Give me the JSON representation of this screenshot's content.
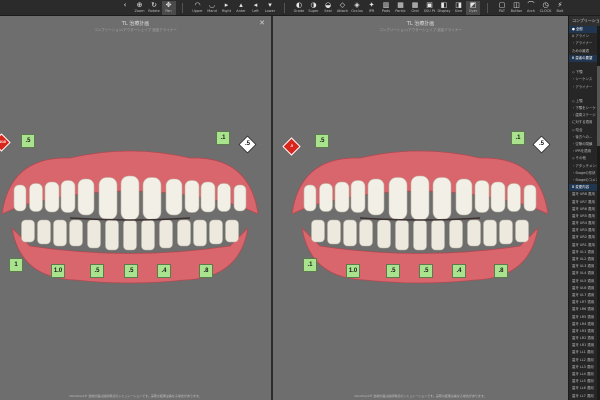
{
  "toolbar": {
    "tools": [
      {
        "label": "",
        "icon": "chevron-left",
        "glyph": "‹"
      },
      {
        "label": "Zoom",
        "icon": "zoom",
        "glyph": "⊕"
      },
      {
        "label": "Rotate",
        "icon": "rotate",
        "glyph": "↻"
      },
      {
        "label": "Pan",
        "icon": "pan",
        "glyph": "✥"
      },
      {
        "label": "",
        "icon": "separator",
        "glyph": ""
      },
      {
        "label": "Upper",
        "icon": "upper",
        "glyph": "◠"
      },
      {
        "label": "Mand",
        "icon": "mand",
        "glyph": "◡"
      },
      {
        "label": "Right",
        "icon": "right",
        "glyph": "▸"
      },
      {
        "label": "Anter",
        "icon": "anter",
        "glyph": "▴"
      },
      {
        "label": "Left",
        "icon": "left",
        "glyph": "◂"
      },
      {
        "label": "Lower",
        "icon": "lower",
        "glyph": "▾"
      },
      {
        "label": "",
        "icon": "separator",
        "glyph": ""
      },
      {
        "label": "Grade",
        "icon": "grade",
        "glyph": "◐"
      },
      {
        "label": "Super",
        "icon": "super",
        "glyph": "◑"
      },
      {
        "label": "Seal",
        "icon": "seal",
        "glyph": "◒"
      },
      {
        "label": "Attach",
        "icon": "attach",
        "glyph": "◇"
      },
      {
        "label": "Occlus",
        "icon": "occlusion",
        "glyph": "◈"
      },
      {
        "label": "IPR",
        "icon": "ipr",
        "glyph": "✦"
      },
      {
        "label": "Pads",
        "icon": "pads",
        "glyph": "▥"
      },
      {
        "label": "Pontic",
        "icon": "pontic",
        "glyph": "▦"
      },
      {
        "label": "Grid",
        "icon": "grid",
        "glyph": "▦"
      },
      {
        "label": "SSU Pt",
        "icon": "ssu",
        "glyph": "▣"
      },
      {
        "label": "Display",
        "icon": "display",
        "glyph": "◧"
      },
      {
        "label": "Sine",
        "icon": "sine",
        "glyph": "◨"
      },
      {
        "label": "Over",
        "icon": "over",
        "glyph": "◩"
      },
      {
        "label": "",
        "icon": "separator",
        "glyph": ""
      },
      {
        "label": "PAT",
        "icon": "pat",
        "glyph": "▢"
      },
      {
        "label": "Button",
        "icon": "button",
        "glyph": "◫"
      },
      {
        "label": "Arch",
        "icon": "arch",
        "glyph": "⌒"
      },
      {
        "label": "CLOCK",
        "icon": "clock",
        "glyph": "◷"
      },
      {
        "label": "Bolt",
        "icon": "bolt",
        "glyph": "⚡"
      }
    ]
  },
  "viewports": [
    {
      "title": "TL 治療計画",
      "subtitle": "コンプリーション/アウターシェイプ 追加アライナー",
      "footer": "ClinCheck® 治療計画は提供時点のシミュレーションです。実際の結果は異なる場合があります。",
      "labels": [
        ".5",
        ".1",
        "1",
        "1.0",
        ".5",
        ".5",
        ".4",
        ".8"
      ],
      "diamond_white": ".5",
      "diamond_red": "14/15"
    },
    {
      "title": "",
      "subtitle": "",
      "footer": "ClinCheck® 治療計画は提供時点のシミュレーションです。実際の結果は異なる場合があります。",
      "labels": [
        ".5",
        ".1",
        ".1",
        "1.0",
        ".5",
        ".5",
        ".4",
        ".8"
      ],
      "diamond_white": ".5",
      "diamond_red": ".5"
    }
  ],
  "side_panel": {
    "title": "コンプリーション",
    "rows": [
      {
        "text": "● 全般",
        "head": true
      },
      {
        "text": "A アライン",
        "head": false
      },
      {
        "text": "・アライナー",
        "head": false
      },
      {
        "text": "ための最適",
        "head": false
      },
      {
        "text": "B 患者の要望",
        "head": true
      },
      {
        "text": "",
        "head": false
      },
      {
        "text": "◇ 下顎",
        "head": false
      },
      {
        "text": "・シーケンス",
        "head": false
      },
      {
        "text": "・アライナー",
        "head": false
      },
      {
        "text": "",
        "head": false
      },
      {
        "text": "◇ 上顎",
        "head": false
      },
      {
        "text": "・下顎をシーケ",
        "head": false
      },
      {
        "text": "・歯周ステージ",
        "head": false
      },
      {
        "text": "に対する適用",
        "head": false
      },
      {
        "text": "◇ 咬合",
        "head": false
      },
      {
        "text": "・後方への…",
        "head": false
      },
      {
        "text": "・空隙の閉鎖",
        "head": false
      },
      {
        "text": "・IPRを適用",
        "head": false
      },
      {
        "text": "◇ その他",
        "head": false
      },
      {
        "text": "・アタッチメント",
        "head": false
      },
      {
        "text": "・Stageの形状",
        "head": false
      },
      {
        "text": "・Stageのコメント",
        "head": false
      },
      {
        "text": "B 変更内容",
        "head": true
      },
      {
        "text": "歯牙 UR8 適用",
        "head": false
      },
      {
        "text": "歯牙 UR7 適用",
        "head": false
      },
      {
        "text": "歯牙 UR6 適用",
        "head": false
      },
      {
        "text": "歯牙 UR5 適用",
        "head": false
      },
      {
        "text": "歯牙 UR4 適用",
        "head": false
      },
      {
        "text": "歯牙 UR3 適用",
        "head": false
      },
      {
        "text": "歯牙 UR2 適用",
        "head": false
      },
      {
        "text": "歯牙 UR1 適用",
        "head": false
      },
      {
        "text": "歯牙 UL1 適用",
        "head": false
      },
      {
        "text": "歯牙 UL2 適用",
        "head": false
      },
      {
        "text": "歯牙 UL3 適用",
        "head": false
      },
      {
        "text": "歯牙 UL4 適用",
        "head": false
      },
      {
        "text": "歯牙 UL5 適用",
        "head": false
      },
      {
        "text": "歯牙 UL6 適用",
        "head": false
      },
      {
        "text": "歯牙 UL7 適用",
        "head": false
      },
      {
        "text": "歯牙 LR7 適用",
        "head": false
      },
      {
        "text": "歯牙 LR6 適用",
        "head": false
      },
      {
        "text": "歯牙 LR5 適用",
        "head": false
      },
      {
        "text": "歯牙 LR4 適用",
        "head": false
      },
      {
        "text": "歯牙 LR3 適用",
        "head": false
      },
      {
        "text": "歯牙 LR2 適用",
        "head": false
      },
      {
        "text": "歯牙 LR1 適用",
        "head": false
      },
      {
        "text": "歯牙 LL1 適用",
        "head": false
      },
      {
        "text": "歯牙 LL2 適用",
        "head": false
      },
      {
        "text": "歯牙 LL3 適用",
        "head": false
      },
      {
        "text": "歯牙 LL4 適用",
        "head": false
      },
      {
        "text": "歯牙 LL5 適用",
        "head": false
      },
      {
        "text": "歯牙 LL6 適用",
        "head": false
      },
      {
        "text": "歯牙 LL7 適用",
        "head": false
      }
    ]
  },
  "colors": {
    "viewport_bg": "#6e6e6e",
    "gum": "#d9666c",
    "tooth": "#f2efe6",
    "ipr_label": "#a9e38d",
    "alert_red": "#d9261c"
  }
}
